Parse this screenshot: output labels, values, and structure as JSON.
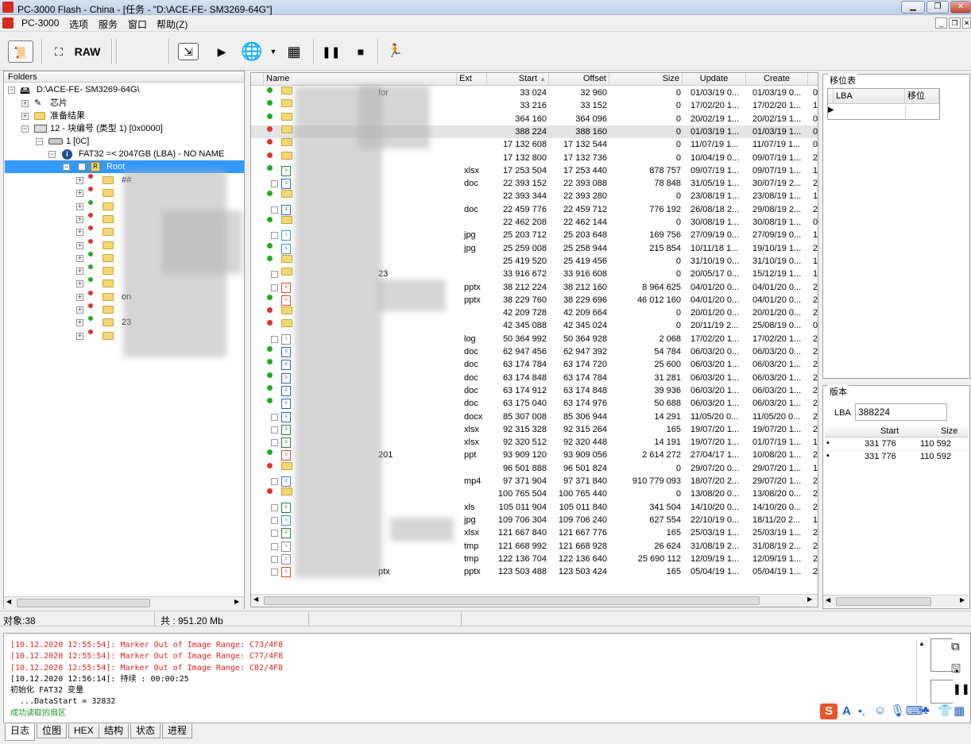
{
  "title": {
    "text": "PC-3000 Flash - China - [任务 - \"D:\\ACE-FE-      SM3269-64G\"]"
  },
  "menu": [
    "PC-3000",
    "选项",
    "服务",
    "窗口",
    "帮助(Z)"
  ],
  "toolbar": {
    "raw": "RAW"
  },
  "folders": {
    "header": "Folders",
    "root": "D:\\ACE-FE-      SM3269-64G\\",
    "chip": "芯片",
    "prep": "准备结果",
    "block": "12 - 块编号 (类型 1) [0x0000]",
    "part": "1 [0C]",
    "fat": "FAT32 =< 2047GB (LBA) - NO NAME",
    "rootlabel": "Root",
    "sub": [
      "##",
      "",
      "",
      "",
      "",
      "",
      "",
      "",
      "",
      "on",
      "",
      "23",
      ""
    ]
  },
  "files": {
    "cols": [
      "Name",
      "Ext",
      "Start",
      "Offset",
      "Size",
      "Update",
      "Create"
    ],
    "rows": [
      [
        "for",
        "",
        "33 024",
        "32 960",
        "0",
        "01/03/19 0...",
        "01/03/19 0..."
      ],
      [
        "",
        "",
        "33 216",
        "33 152",
        "0",
        "17/02/20 1...",
        "17/02/20 1..."
      ],
      [
        "",
        "",
        "364 160",
        "364 096",
        "0",
        "20/02/19 1...",
        "20/02/19 1..."
      ],
      [
        "",
        "",
        "388 224",
        "388 160",
        "0",
        "01/03/19 1...",
        "01/03/19 1..."
      ],
      [
        "",
        "",
        "17 132 608",
        "17 132 544",
        "0",
        "11/07/19 1...",
        "11/07/19 1..."
      ],
      [
        "",
        "",
        "17 132 800",
        "17 132 736",
        "0",
        "10/04/19 0...",
        "09/07/19 1..."
      ],
      [
        "",
        "xlsx",
        "17 253 504",
        "17 253 440",
        "878 757",
        "09/07/19 1...",
        "09/07/19 1..."
      ],
      [
        "",
        "doc",
        "22 393 152",
        "22 393 088",
        "78 848",
        "31/05/19 1...",
        "30/07/19 2..."
      ],
      [
        "",
        "",
        "22 393 344",
        "22 393 280",
        "0",
        "23/08/19 1...",
        "23/08/19 1..."
      ],
      [
        "",
        "doc",
        "22 459 776",
        "22 459 712",
        "776 192",
        "26/08/18 2...",
        "29/08/19 2..."
      ],
      [
        "",
        "",
        "22 462 208",
        "22 462 144",
        "0",
        "30/08/19 1...",
        "30/08/19 1..."
      ],
      [
        "",
        "jpg",
        "25 203 712",
        "25 203 648",
        "169 756",
        "27/09/19 0...",
        "27/09/19 0..."
      ],
      [
        "",
        "jpg",
        "25 259 008",
        "25 258 944",
        "215 854",
        "10/11/18 1...",
        "19/10/19 1..."
      ],
      [
        "",
        "",
        "25 419 520",
        "25 419 456",
        "0",
        "31/10/19 0...",
        "31/10/19 0..."
      ],
      [
        "23",
        "",
        "33 916 672",
        "33 916 608",
        "0",
        "20/05/17 0...",
        "15/12/19 1..."
      ],
      [
        "",
        "pptx",
        "38 212 224",
        "38 212 160",
        "8 964 625",
        "04/01/20 0...",
        "04/01/20 0..."
      ],
      [
        "",
        "pptx",
        "38 229 760",
        "38 229 696",
        "46 012 160",
        "04/01/20 0...",
        "04/01/20 0..."
      ],
      [
        "",
        "",
        "42 209 728",
        "42 209 664",
        "0",
        "20/01/20 0...",
        "20/01/20 0..."
      ],
      [
        "",
        "",
        "42 345 088",
        "42 345 024",
        "0",
        "20/11/19 2...",
        "25/08/19 0..."
      ],
      [
        "",
        "log",
        "50 364 992",
        "50 364 928",
        "2 068",
        "17/02/20 1...",
        "17/02/20 1..."
      ],
      [
        "",
        "doc",
        "62 947 456",
        "62 947 392",
        "54 784",
        "06/03/20 0...",
        "06/03/20 0..."
      ],
      [
        "",
        "doc",
        "63 174 784",
        "63 174 720",
        "25 600",
        "06/03/20 1...",
        "06/03/20 1..."
      ],
      [
        "",
        "doc",
        "63 174 848",
        "63 174 784",
        "31 281",
        "06/03/20 1...",
        "06/03/20 1..."
      ],
      [
        "",
        "doc",
        "63 174 912",
        "63 174 848",
        "39 936",
        "06/03/20 1...",
        "06/03/20 1..."
      ],
      [
        "",
        "doc",
        "63 175 040",
        "63 174 976",
        "50 688",
        "06/03/20 1...",
        "06/03/20 1..."
      ],
      [
        "",
        "docx",
        "85 307 008",
        "85 306 944",
        "14 291",
        "11/05/20 0...",
        "11/05/20 0..."
      ],
      [
        "",
        "xlsx",
        "92 315 328",
        "92 315 264",
        "165",
        "19/07/20 1...",
        "19/07/20 1..."
      ],
      [
        "",
        "xlsx",
        "92 320 512",
        "92 320 448",
        "14 191",
        "19/07/20 1...",
        "01/07/19 1..."
      ],
      [
        "201",
        "ppt",
        "93 909 120",
        "93 909 056",
        "2 614 272",
        "27/04/17 1...",
        "10/08/20 1..."
      ],
      [
        "",
        "",
        "96 501 888",
        "96 501 824",
        "0",
        "29/07/20 0...",
        "29/07/20 1..."
      ],
      [
        "",
        "mp4",
        "97 371 904",
        "97 371 840",
        "910 779 093",
        "18/07/20 2...",
        "29/07/20 1..."
      ],
      [
        "",
        "",
        "100 765 504",
        "100 765 440",
        "0",
        "13/08/20 0...",
        "13/08/20 0..."
      ],
      [
        "",
        "xls",
        "105 011 904",
        "105 011 840",
        "341 504",
        "14/10/20 0...",
        "14/10/20 0..."
      ],
      [
        "",
        "jpg",
        "109 706 304",
        "109 706 240",
        "627 554",
        "22/10/19 0...",
        "18/11/20 2..."
      ],
      [
        "",
        "xlsx",
        "121 667 840",
        "121 667 776",
        "165",
        "25/03/19 1...",
        "25/03/19 1..."
      ],
      [
        "",
        "tmp",
        "121 668 992",
        "121 668 928",
        "26 624",
        "31/08/19 2...",
        "31/08/19 2..."
      ],
      [
        "",
        "tmp",
        "122 136 704",
        "122 136 640",
        "25 690 112",
        "12/09/19 1...",
        "12/09/19 1..."
      ],
      [
        "ptx",
        "pptx",
        "123 503 488",
        "123 503 424",
        "165",
        "05/04/19 1...",
        "05/04/19 1..."
      ]
    ],
    "extra": [
      "0",
      "1",
      "0",
      "0",
      "0",
      "2",
      "1",
      "2",
      "1",
      "2",
      "0",
      "1",
      "2",
      "1",
      "1",
      "2",
      "2",
      "2",
      "0",
      "2",
      "2",
      "2",
      "2",
      "2",
      "2",
      "2",
      "2",
      "1",
      "2",
      "1",
      "2",
      "2",
      "2",
      "1",
      "2",
      "2",
      "2",
      "2"
    ]
  },
  "remap": {
    "title": "移位表",
    "col_lba": "LBA",
    "col_shift": "移位"
  },
  "version": {
    "title": "版本",
    "lba_label": "LBA",
    "lba_value": "388224",
    "col_start": "Start",
    "col_size": "Size",
    "rows": [
      [
        "331 776",
        "110 592"
      ],
      [
        "331 776",
        "110 592"
      ]
    ]
  },
  "status": {
    "objects": "对象:38",
    "total": "共 : 951.20 Mb"
  },
  "log": [
    {
      "t": "[10.12.2020 12:55:54]: Marker Out of Image Range: C73/4F8",
      "c": "#d22"
    },
    {
      "t": "[10.12.2020 12:55:54]: Marker Out of Image Range: C77/4F8",
      "c": "#d22"
    },
    {
      "t": "[10.12.2020 12:55:54]: Marker Out of Image Range: C82/4F8",
      "c": "#d22"
    },
    {
      "t": "[10.12.2020 12:56:14]: 持续 : 00:00:25",
      "c": "#000"
    },
    {
      "t": "初始化 FAT32 变量",
      "c": "#000"
    },
    {
      "t": "  ...DataStart = 32832",
      "c": "#000"
    },
    {
      "t": "成功读取的扇区",
      "c": "#1a9a1a"
    }
  ],
  "tabs": [
    "日志",
    "位图",
    "HEX",
    "结构",
    "状态",
    "进程"
  ]
}
